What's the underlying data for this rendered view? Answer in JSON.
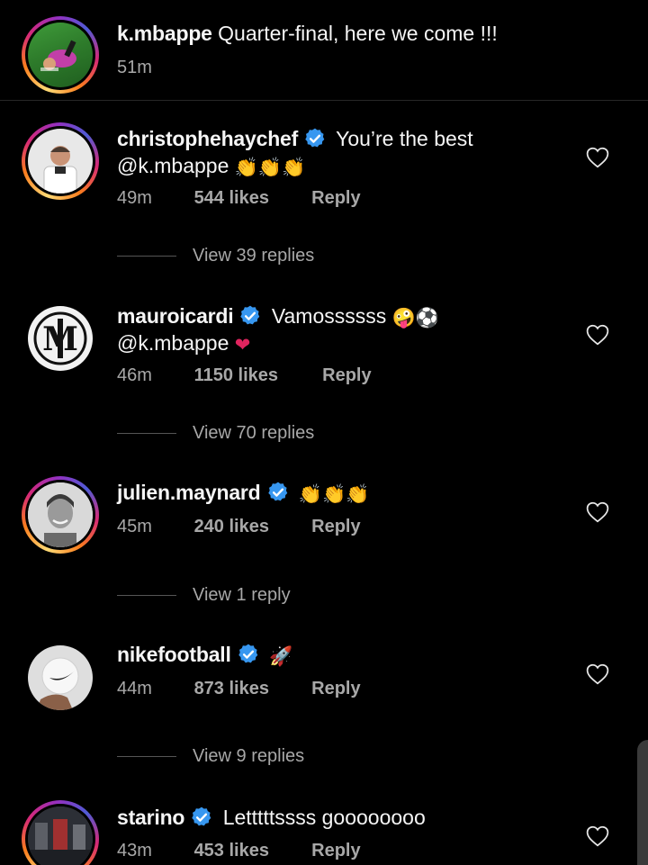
{
  "caption": {
    "username": "k.mbappe",
    "text": "Quarter-final, here we come !!!",
    "time": "51m"
  },
  "comments": [
    {
      "username": "christophehaychef",
      "verified": true,
      "text_line1": "You’re the best",
      "text_line2": "@k.mbappe",
      "emoji": "👏👏👏",
      "time": "49m",
      "likes": "544 likes",
      "reply": "Reply",
      "view_replies": "View 39 replies"
    },
    {
      "username": "mauroicardi",
      "verified": true,
      "text_line1": "Vamossssss",
      "emoji1": "🤪⚽",
      "text_line2": "@k.mbappe",
      "emoji2": "❤",
      "time": "46m",
      "likes": "1150 likes",
      "reply": "Reply",
      "view_replies": "View 70 replies"
    },
    {
      "username": "julien.maynard",
      "verified": true,
      "emoji": "👏👏👏",
      "time": "45m",
      "likes": "240 likes",
      "reply": "Reply",
      "view_replies": "View 1 reply"
    },
    {
      "username": "nikefootball",
      "verified": true,
      "emoji": "🚀",
      "time": "44m",
      "likes": "873 likes",
      "reply": "Reply",
      "view_replies": "View 9 replies"
    },
    {
      "username": "starino",
      "verified": true,
      "text_line1": "Letttttssss goooooooo",
      "time": "43m",
      "likes": "453 likes",
      "reply": "Reply"
    }
  ],
  "colors": {
    "background": "#000000",
    "text": "#f5f5f5",
    "secondary": "#a8a8a8",
    "verified": "#3797f0"
  }
}
